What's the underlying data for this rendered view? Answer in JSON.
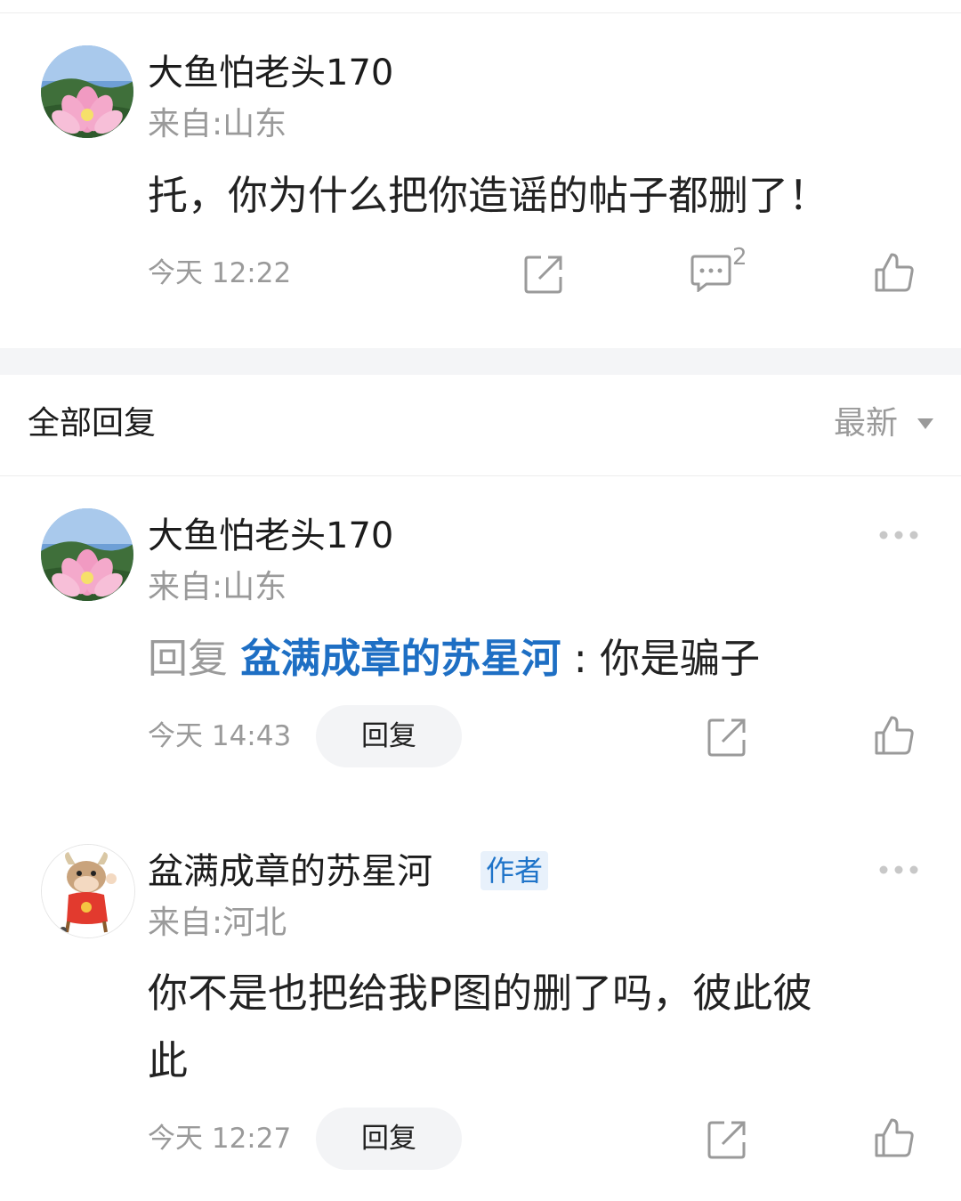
{
  "main_post": {
    "user_name": "大鱼怕老头170",
    "location": "来自:山东",
    "content": "托，你为什么把你造谣的帖子都删了！",
    "time": "今天 12:22",
    "comment_count": "2"
  },
  "section": {
    "title": "全部回复",
    "sort_label": "最新"
  },
  "replies": [
    {
      "user_name": "大鱼怕老头170",
      "location": "来自:山东",
      "reply_prefix": "回复",
      "reply_target": "盆满成章的苏星河",
      "separator": ":",
      "content": "你是骗子",
      "time": "今天 14:43",
      "reply_button": "回复"
    },
    {
      "user_name": "盆满成章的苏星河",
      "badge": "作者",
      "location": "来自:河北",
      "content_line1": "你不是也把给我P图的删了吗，彼此彼",
      "content_line2": "此",
      "time": "今天 12:27",
      "reply_button": "回复"
    }
  ]
}
